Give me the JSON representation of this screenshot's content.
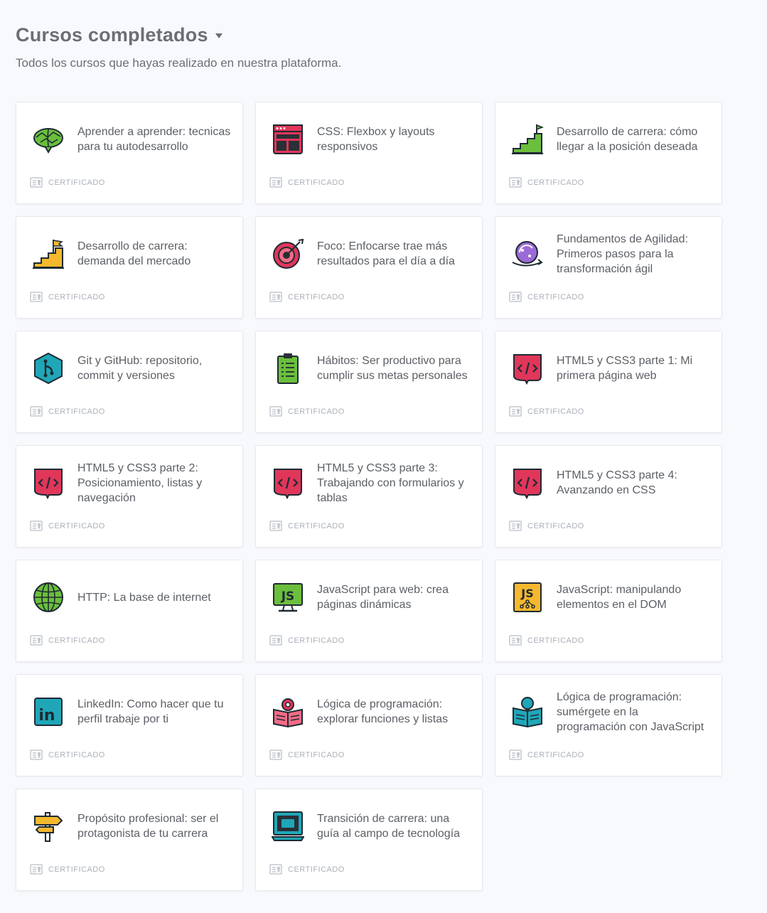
{
  "header": {
    "title": "Cursos completados",
    "subtitle": "Todos los cursos que hayas realizado en nuestra plataforma."
  },
  "courses": [
    {
      "name": "Aprender a aprender: tecnicas para tu autodesarrollo",
      "icon": "brain-icon",
      "cert": "CERTIFICADO"
    },
    {
      "name": "CSS: Flexbox y layouts responsivos",
      "icon": "layout-window-icon",
      "cert": "CERTIFICADO"
    },
    {
      "name": "Desarrollo de carrera: cómo llegar a la posición deseada",
      "icon": "stairs-flag-icon",
      "cert": "CERTIFICADO"
    },
    {
      "name": "Desarrollo de carrera: demanda del mercado",
      "icon": "stairs-flag-icon",
      "cert": "CERTIFICADO"
    },
    {
      "name": "Foco: Enfocarse trae más resultados para el día a día",
      "icon": "target-icon",
      "cert": "CERTIFICADO"
    },
    {
      "name": "Fundamentos de Agilidad: Primeros pasos para la transformación ágil",
      "icon": "agile-cycle-icon",
      "cert": "CERTIFICADO"
    },
    {
      "name": "Git y GitHub: repositorio, commit y versiones",
      "icon": "git-branch-icon",
      "cert": "CERTIFICADO"
    },
    {
      "name": "Hábitos: Ser productivo para cumplir sus metas personales",
      "icon": "clipboard-checklist-icon",
      "cert": "CERTIFICADO"
    },
    {
      "name": "HTML5 y CSS3 parte 1: Mi primera página web",
      "icon": "html-code-icon",
      "cert": "CERTIFICADO"
    },
    {
      "name": "HTML5 y CSS3 parte 2: Posicionamiento, listas y navegación",
      "icon": "html-code-icon",
      "cert": "CERTIFICADO"
    },
    {
      "name": "HTML5 y CSS3 parte 3: Trabajando con formularios y tablas",
      "icon": "html-code-icon",
      "cert": "CERTIFICADO"
    },
    {
      "name": "HTML5 y CSS3 parte 4: Avanzando en CSS",
      "icon": "html-code-icon",
      "cert": "CERTIFICADO"
    },
    {
      "name": "HTTP: La base de internet",
      "icon": "globe-icon",
      "cert": "CERTIFICADO"
    },
    {
      "name": "JavaScript para web: crea páginas dinámicas",
      "icon": "js-monitor-icon",
      "cert": "CERTIFICADO"
    },
    {
      "name": "JavaScript: manipulando elementos en el DOM",
      "icon": "js-dom-icon",
      "cert": "CERTIFICADO"
    },
    {
      "name": "LinkedIn: Como hacer que tu perfil trabaje por ti",
      "icon": "linkedin-icon",
      "cert": "CERTIFICADO"
    },
    {
      "name": "Lógica de programación: explorar funciones y listas",
      "icon": "gear-book-icon",
      "cert": "CERTIFICADO"
    },
    {
      "name": "Lógica de programación: sumérgete en la programación con JavaScript",
      "icon": "lightbulb-book-icon",
      "cert": "CERTIFICADO"
    },
    {
      "name": "Propósito profesional: ser el protagonista de tu carrera",
      "icon": "signpost-icon",
      "cert": "CERTIFICADO"
    },
    {
      "name": "Transición de carrera: una guía al campo de tecnología",
      "icon": "laptop-icon",
      "cert": "CERTIFICADO"
    }
  ],
  "colors": {
    "html": "#e0365a",
    "js": "#f5b82e",
    "teal": "#1fa7b8",
    "green": "#6bbf3c",
    "purple": "#9b6ad6"
  }
}
